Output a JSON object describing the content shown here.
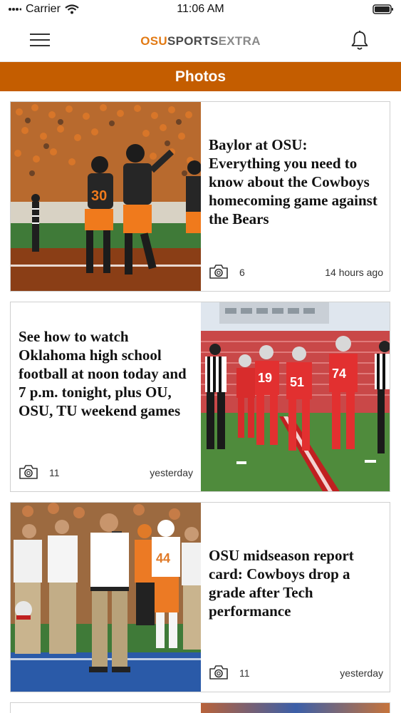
{
  "status_bar": {
    "carrier": "Carrier",
    "time": "11:06 AM"
  },
  "header": {
    "logo": {
      "osu": "OSU",
      "sports": "SPORTS",
      "extra": "EXTRA"
    },
    "menu_icon": "hamburger-icon",
    "bell_icon": "bell-icon"
  },
  "section": {
    "title": "Photos"
  },
  "brand_colors": {
    "orange": "#c45d00",
    "logo_orange": "#e27a14"
  },
  "cards": [
    {
      "headline": "Baylor at OSU: Everything you need to know about the Cowboys homecoming game against the Bears",
      "photo_count": "6",
      "time": "14 hours ago"
    },
    {
      "headline": "See how to watch Oklahoma high school football at noon today and 7 p.m. tonight, plus OU, OSU, TU weekend games",
      "photo_count": "11",
      "time": "yesterday"
    },
    {
      "headline": "OSU midseason report card: Cowboys drop a grade after Tech performance",
      "photo_count": "11",
      "time": "yesterday"
    }
  ]
}
